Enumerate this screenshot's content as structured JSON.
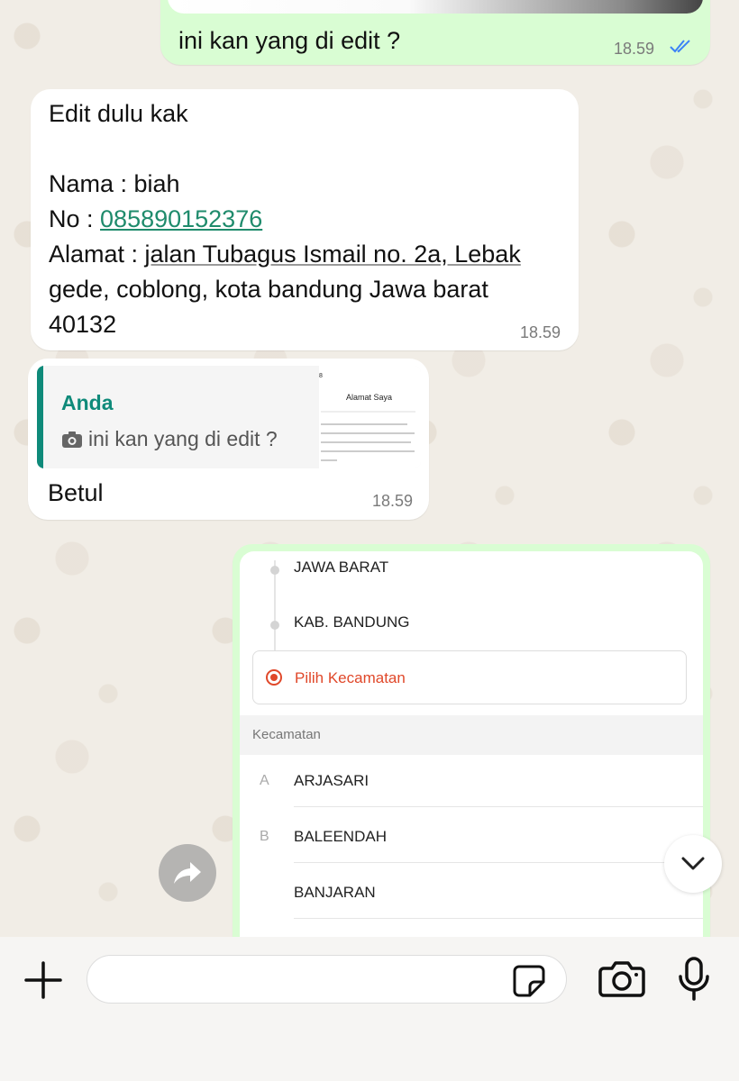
{
  "messages": {
    "m1": {
      "text": "ini kan yang di edit ?",
      "time": "18.59",
      "status": "read"
    },
    "m2": {
      "line1": "Edit dulu kak",
      "name_line": "Nama : biah",
      "phone_prefix": "No : ",
      "phone": "085890152376",
      "address_prefix": "Alamat : ",
      "address_1": "jalan Tubagus Ismail no. 2a, Lebak",
      "address_2": "gede, coblong, kota bandung Jawa barat",
      "address_3": "40132",
      "time": "18.59"
    },
    "m3": {
      "quote_author": "Anda",
      "quote_text": "ini kan yang di edit ?",
      "thumb_title": "Alamat Saya",
      "thumb_status": "8",
      "reply": "Betul",
      "time": "18.59"
    },
    "m4": {
      "steps": [
        "JAWA BARAT",
        "KAB. BANDUNG"
      ],
      "picker_label": "Pilih Kecamatan",
      "section_label": "Kecamatan",
      "items": [
        {
          "letter": "A",
          "name": "ARJASARI"
        },
        {
          "letter": "B",
          "name": "BALEENDAH"
        },
        {
          "letter": "",
          "name": "BANJARAN"
        }
      ]
    }
  },
  "composer": {
    "placeholder": "",
    "value": ""
  },
  "colors": {
    "outgoing": "#d9fdd3",
    "incoming": "#ffffff",
    "accent": "#0f8a7a",
    "link": "#1f8b6c",
    "tick": "#3b82f6",
    "picker": "#e0482a"
  },
  "icons": [
    "double-check-icon",
    "camera-icon",
    "forward-icon",
    "chevron-down-icon",
    "plus-icon",
    "sticker-icon",
    "mic-icon"
  ]
}
